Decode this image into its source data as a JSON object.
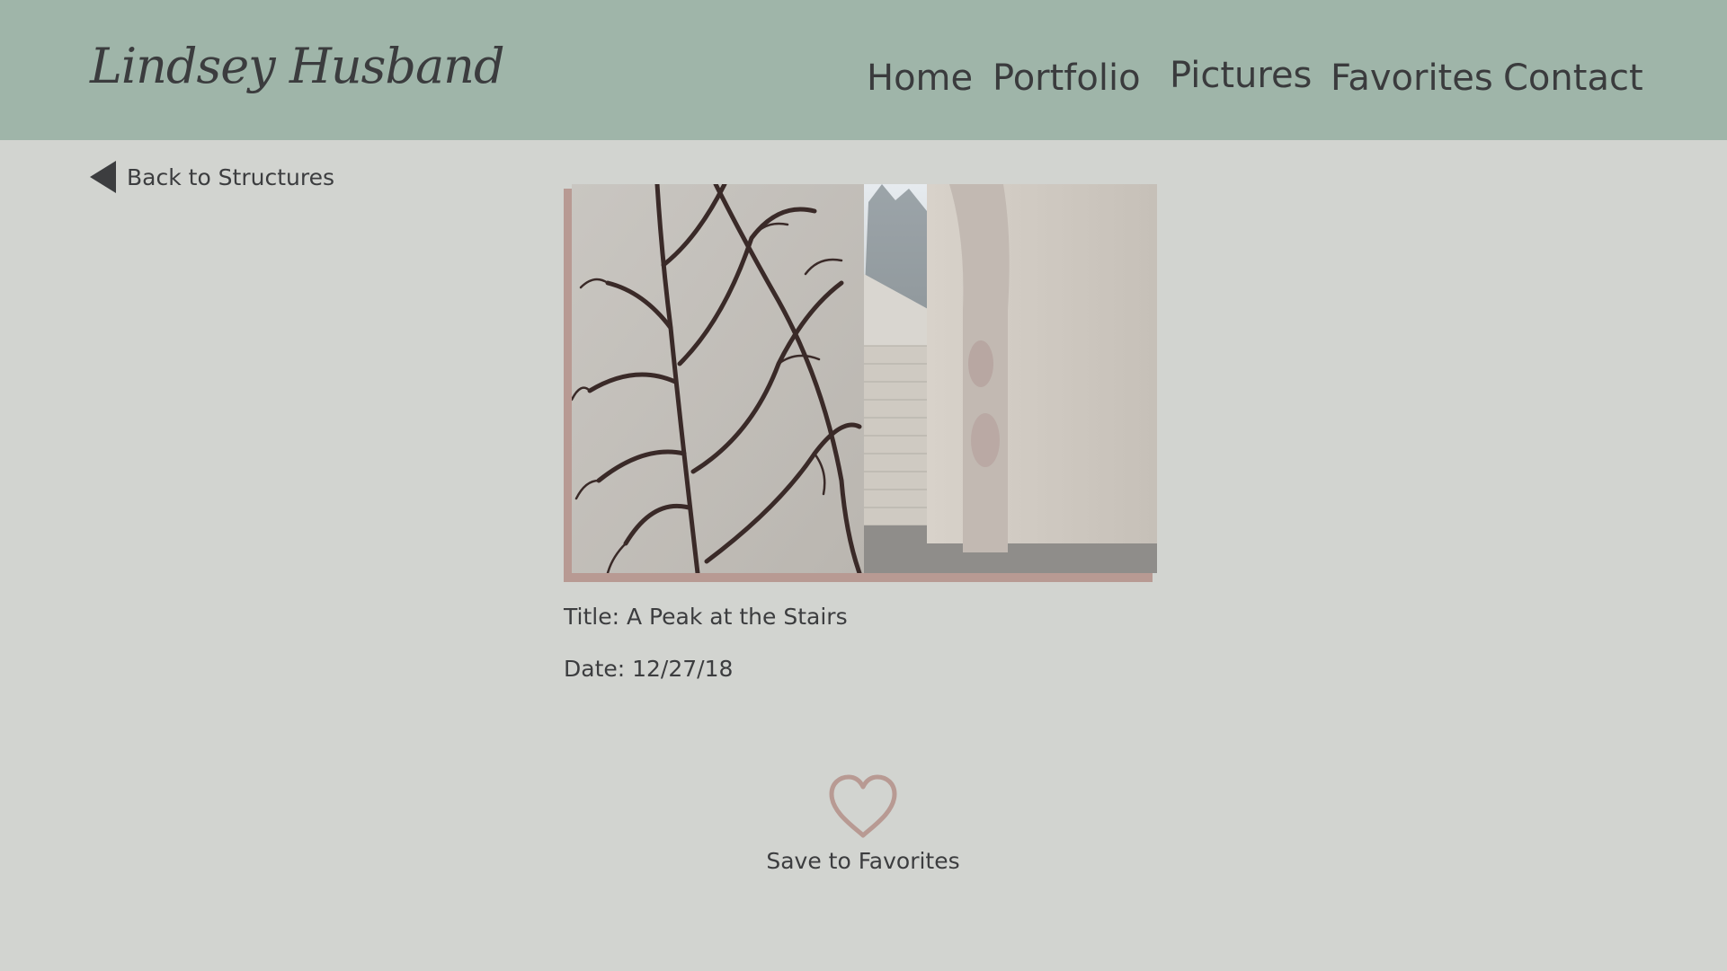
{
  "header": {
    "logo": "Lindsey Husband",
    "nav": {
      "home": "Home",
      "portfolio": "Portfolio",
      "pictures": "Pictures",
      "favorites": "Favorites",
      "contact": "Contact"
    },
    "background_color": "#9fb5a9"
  },
  "page": {
    "background_color": "#d2d4d0",
    "back_link": {
      "label": "Back to Structures",
      "icon": "triangle-left-icon"
    }
  },
  "photo": {
    "subject": "photo-stairs-vines",
    "accent_color": "#b89a93"
  },
  "details": {
    "title": "Title: A Peak at the Stairs",
    "date": "Date: 12/27/18"
  },
  "favorite": {
    "icon": "heart-icon",
    "label": "Save to Favorites",
    "icon_color": "#b89a93"
  }
}
